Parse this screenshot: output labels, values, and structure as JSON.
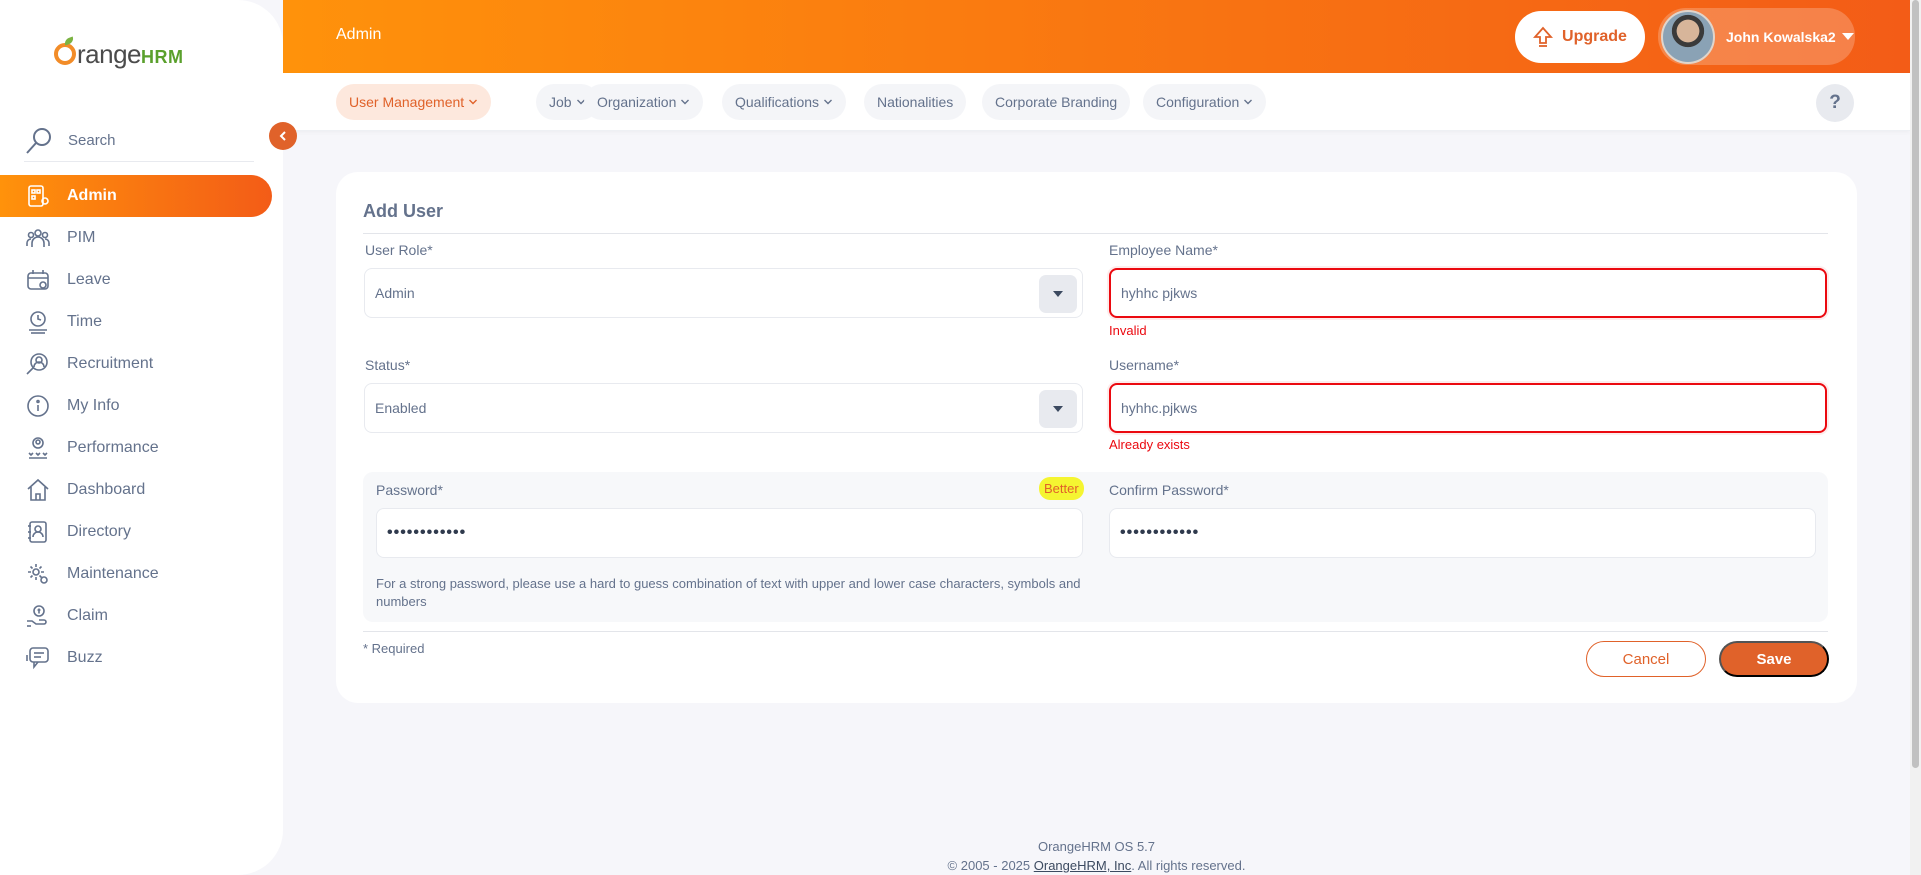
{
  "brand": {
    "name_part1": "range",
    "name_part2": "HRM"
  },
  "sidebar": {
    "search_placeholder": "Search",
    "items": [
      {
        "label": "Admin",
        "icon": "admin-icon",
        "active": true
      },
      {
        "label": "PIM",
        "icon": "pim-icon"
      },
      {
        "label": "Leave",
        "icon": "leave-icon"
      },
      {
        "label": "Time",
        "icon": "time-icon"
      },
      {
        "label": "Recruitment",
        "icon": "recruitment-icon"
      },
      {
        "label": "My Info",
        "icon": "my-info-icon"
      },
      {
        "label": "Performance",
        "icon": "performance-icon"
      },
      {
        "label": "Dashboard",
        "icon": "dashboard-icon"
      },
      {
        "label": "Directory",
        "icon": "directory-icon"
      },
      {
        "label": "Maintenance",
        "icon": "maintenance-icon"
      },
      {
        "label": "Claim",
        "icon": "claim-icon"
      },
      {
        "label": "Buzz",
        "icon": "buzz-icon"
      }
    ]
  },
  "header": {
    "title": "Admin",
    "upgrade_label": "Upgrade",
    "user_name": "John Kowalska2"
  },
  "tabs": [
    {
      "label": "User Management",
      "has_dropdown": true,
      "active": true
    },
    {
      "label": "Job",
      "has_dropdown": true
    },
    {
      "label": "Organization",
      "has_dropdown": true
    },
    {
      "label": "Qualifications",
      "has_dropdown": true
    },
    {
      "label": "Nationalities",
      "has_dropdown": false
    },
    {
      "label": "Corporate Branding",
      "has_dropdown": false
    },
    {
      "label": "Configuration",
      "has_dropdown": true
    }
  ],
  "help_label": "?",
  "form": {
    "title": "Add User",
    "user_role": {
      "label": "User Role*",
      "value": "Admin"
    },
    "employee_name": {
      "label": "Employee Name*",
      "value": "hyhhc pjkws",
      "error": "Invalid"
    },
    "status": {
      "label": "Status*",
      "value": "Enabled"
    },
    "username": {
      "label": "Username*",
      "value": "hyhhc.pjkws",
      "error": "Already exists"
    },
    "password": {
      "label": "Password*",
      "value": "••••••••••••",
      "strength": "Better"
    },
    "confirm_password": {
      "label": "Confirm Password*",
      "value": "••••••••••••"
    },
    "password_hint": "For a strong password, please use a hard to guess combination of text with upper and lower case characters, symbols and numbers",
    "required_note": "* Required",
    "cancel_label": "Cancel",
    "save_label": "Save"
  },
  "footer": {
    "version": "OrangeHRM OS 5.7",
    "copyright_prefix": "© 2005 - 2025 ",
    "company_link": "OrangeHRM, Inc",
    "copyright_suffix": ". All rights reserved."
  },
  "colors": {
    "accent": "#e0622a",
    "gradient_start": "#ff920b",
    "gradient_end": "#f35c17",
    "error": "#eb0910",
    "strength_badge": "#f5f531"
  }
}
